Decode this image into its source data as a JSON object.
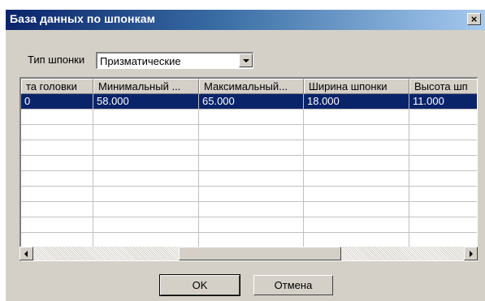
{
  "window": {
    "title": "База данных по шпонкам",
    "close_label": "×"
  },
  "filter": {
    "label": "Тип шпонки",
    "value": "Призматические"
  },
  "table": {
    "columns": [
      "та головки",
      "Минимальный ...",
      "Максимальный...",
      "Ширина шпонки",
      "Высота шп"
    ],
    "rows": [
      [
        "0",
        "58.000",
        "65.000",
        "18.000",
        "11.000"
      ]
    ],
    "empty_rows": 9
  },
  "buttons": {
    "ok": "OK",
    "cancel": "Отмена"
  },
  "colors": {
    "selection": "#0a246a",
    "title_start": "#0a246a",
    "title_end": "#a6caf0",
    "face": "#d4d0c8"
  }
}
